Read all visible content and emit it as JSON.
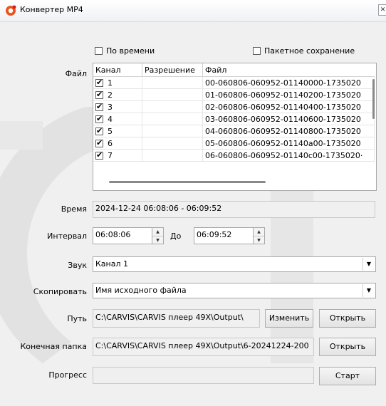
{
  "window": {
    "title": "Конвертер MP4",
    "close_glyph": "✕"
  },
  "options": {
    "by_time_label": "По времени",
    "batch_save_label": "Пакетное сохранение"
  },
  "file": {
    "label": "Файл",
    "columns": [
      "Канал",
      "Разрешение",
      "Файл"
    ],
    "rows": [
      {
        "channel": "1",
        "resolution": "",
        "file": "00-060806-060952-01140000-1735020"
      },
      {
        "channel": "2",
        "resolution": "",
        "file": "01-060806-060952-01140200-1735020"
      },
      {
        "channel": "3",
        "resolution": "",
        "file": "02-060806-060952-01140400-1735020"
      },
      {
        "channel": "4",
        "resolution": "",
        "file": "03-060806-060952-01140600-1735020"
      },
      {
        "channel": "5",
        "resolution": "",
        "file": "04-060806-060952-01140800-1735020"
      },
      {
        "channel": "6",
        "resolution": "",
        "file": "05-060806-060952-01140a00-1735020"
      },
      {
        "channel": "7",
        "resolution": "",
        "file": "06-060806-060952-01140c00-1735020·"
      }
    ]
  },
  "time": {
    "label": "Время",
    "value": "2024-12-24 06:08:06 - 06:09:52"
  },
  "interval": {
    "label": "Интервал",
    "from": "06:08:06",
    "to_label": "До",
    "to": "06:09:52"
  },
  "sound": {
    "label": "Звук",
    "value": "Канал 1"
  },
  "copy": {
    "label": "Скопировать",
    "value": "Имя исходного файла"
  },
  "path": {
    "label": "Путь",
    "value": "C:\\CARVIS\\CARVIS плеер 49X\\Output\\",
    "change_label": "Изменить",
    "open_label": "Открыть"
  },
  "dest": {
    "label": "Конечная папка",
    "value": "C:\\CARVIS\\CARVIS плеер 49X\\Output\\6-20241224-200",
    "open_label": "Открыть"
  },
  "progress": {
    "label": "Прогресс",
    "value": 0,
    "start_label": "Старт"
  }
}
